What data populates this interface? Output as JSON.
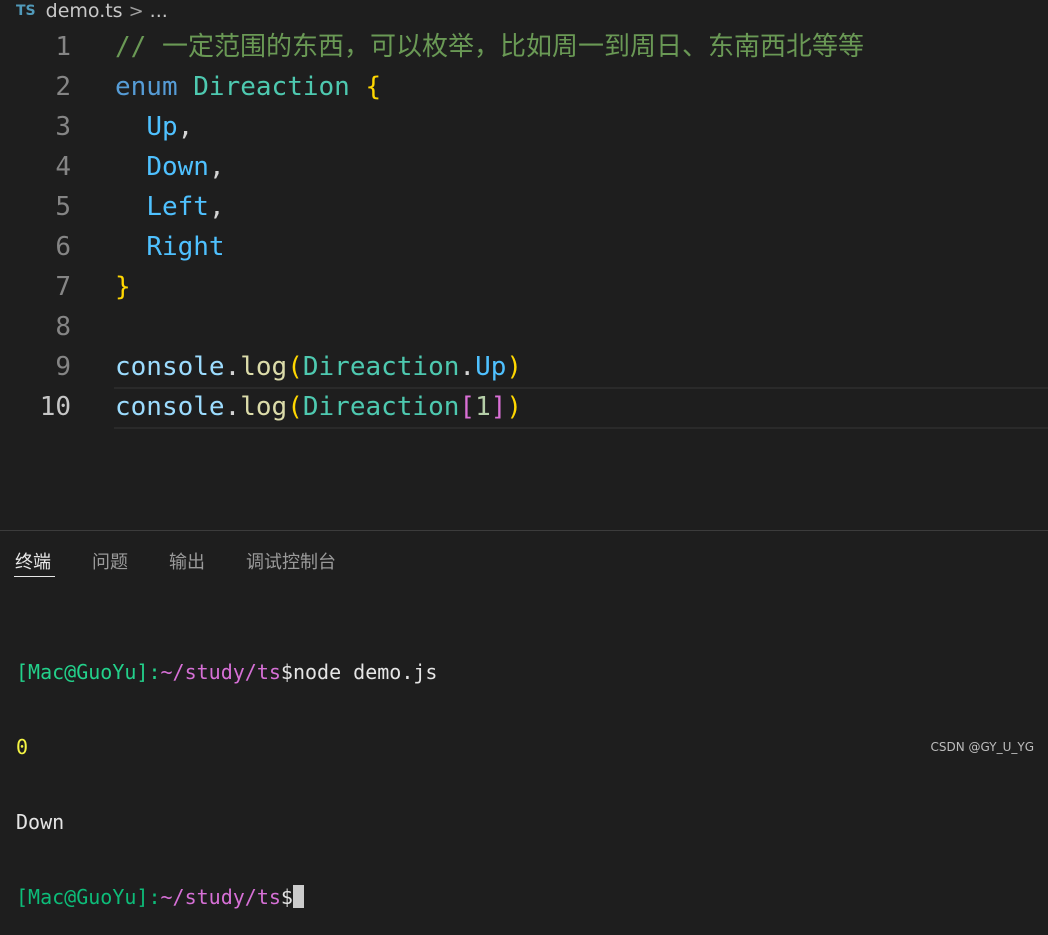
{
  "breadcrumb": {
    "badge": "TS",
    "file": "demo.ts",
    "separator": ">",
    "more": "..."
  },
  "editor": {
    "lines": [
      {
        "num": "1",
        "tokens": [
          {
            "t": "// 一定范围的东西，可以枚举，比如周一到周日、东南西北等等",
            "k": "comment"
          }
        ]
      },
      {
        "num": "2",
        "tokens": [
          {
            "t": "enum",
            "k": "kw"
          },
          {
            "t": " ",
            "k": "plain"
          },
          {
            "t": "Direaction",
            "k": "type"
          },
          {
            "t": " ",
            "k": "plain"
          },
          {
            "t": "{",
            "k": "brace"
          }
        ]
      },
      {
        "num": "3",
        "tokens": [
          {
            "t": "  ",
            "k": "plain"
          },
          {
            "t": "Up",
            "k": "member"
          },
          {
            "t": ",",
            "k": "plain"
          }
        ]
      },
      {
        "num": "4",
        "tokens": [
          {
            "t": "  ",
            "k": "plain"
          },
          {
            "t": "Down",
            "k": "member"
          },
          {
            "t": ",",
            "k": "plain"
          }
        ]
      },
      {
        "num": "5",
        "tokens": [
          {
            "t": "  ",
            "k": "plain"
          },
          {
            "t": "Left",
            "k": "member"
          },
          {
            "t": ",",
            "k": "plain"
          }
        ]
      },
      {
        "num": "6",
        "tokens": [
          {
            "t": "  ",
            "k": "plain"
          },
          {
            "t": "Right",
            "k": "member"
          }
        ]
      },
      {
        "num": "7",
        "tokens": [
          {
            "t": "}",
            "k": "brace"
          }
        ]
      },
      {
        "num": "8",
        "tokens": []
      },
      {
        "num": "9",
        "tokens": [
          {
            "t": "console",
            "k": "var"
          },
          {
            "t": ".",
            "k": "plain"
          },
          {
            "t": "log",
            "k": "fn"
          },
          {
            "t": "(",
            "k": "brace"
          },
          {
            "t": "Direaction",
            "k": "type"
          },
          {
            "t": ".",
            "k": "plain"
          },
          {
            "t": "Up",
            "k": "member"
          },
          {
            "t": ")",
            "k": "brace"
          }
        ]
      },
      {
        "num": "10",
        "current": true,
        "tokens": [
          {
            "t": "console",
            "k": "var"
          },
          {
            "t": ".",
            "k": "plain"
          },
          {
            "t": "log",
            "k": "fn"
          },
          {
            "t": "(",
            "k": "brace"
          },
          {
            "t": "Direaction",
            "k": "type"
          },
          {
            "t": "[",
            "k": "bracket2"
          },
          {
            "t": "1",
            "k": "num"
          },
          {
            "t": "]",
            "k": "bracket2"
          },
          {
            "t": ")",
            "k": "brace"
          }
        ]
      }
    ]
  },
  "panel": {
    "tabs": [
      {
        "label": "终端",
        "active": true
      },
      {
        "label": "问题",
        "active": false
      },
      {
        "label": "输出",
        "active": false
      },
      {
        "label": "调试控制台",
        "active": false
      }
    ]
  },
  "terminal": {
    "prompt_user": "[Mac@GuoYu]:",
    "prompt_path": "~/study/ts",
    "prompt_symbol": "$",
    "command": "node demo.js",
    "output_1": "0",
    "output_2": "Down"
  },
  "watermark": "CSDN @GY_U_YG",
  "colors": {
    "background": "#1e1e1e",
    "comment": "#6a9955",
    "keyword": "#569cd6",
    "type": "#4ec9b0",
    "member": "#4fc1ff",
    "brace": "#ffd700",
    "prompt_green": "#23d18b",
    "prompt_magenta": "#d670d6",
    "number_output": "#f5f543"
  },
  "icons": {
    "breadcrumb_badge": "typescript-file-icon",
    "separator": "chevron-right-icon"
  }
}
